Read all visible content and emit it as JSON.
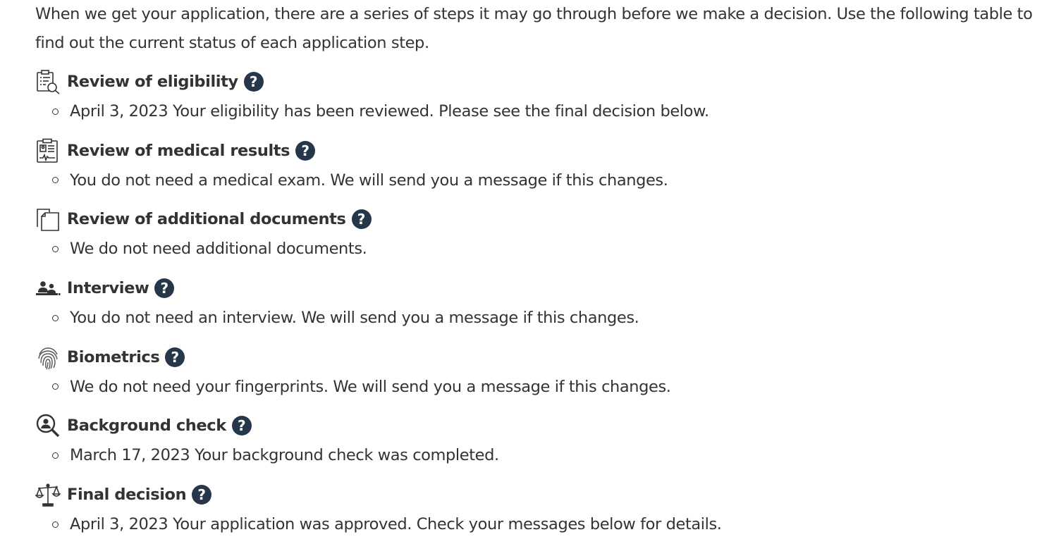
{
  "intro": "When we get your application, there are a series of steps it may go through before we make a decision. Use the following table to find out the current status of each application step.",
  "steps": [
    {
      "icon": "eligibility-clipboard-icon",
      "title": "Review of eligibility",
      "status": "April 3, 2023 Your eligibility has been reviewed. Please see the final decision below."
    },
    {
      "icon": "medical-clipboard-icon",
      "title": "Review of medical results",
      "status": "You do not need a medical exam. We will send you a message if this changes."
    },
    {
      "icon": "documents-icon",
      "title": "Review of additional documents",
      "status": "We do not need additional documents."
    },
    {
      "icon": "interview-people-icon",
      "title": "Interview",
      "status": "You do not need an interview. We will send you a message if this changes."
    },
    {
      "icon": "fingerprint-icon",
      "title": "Biometrics",
      "status": "We do not need your fingerprints. We will send you a message if this changes."
    },
    {
      "icon": "background-search-icon",
      "title": "Background check",
      "status": "March 17, 2023 Your background check was completed."
    },
    {
      "icon": "scales-icon",
      "title": "Final decision",
      "status": "April 3, 2023 Your application was approved. Check your messages below for details."
    }
  ],
  "help_glyph": "?",
  "colors": {
    "text": "#333333",
    "help_button": "#26374a"
  }
}
